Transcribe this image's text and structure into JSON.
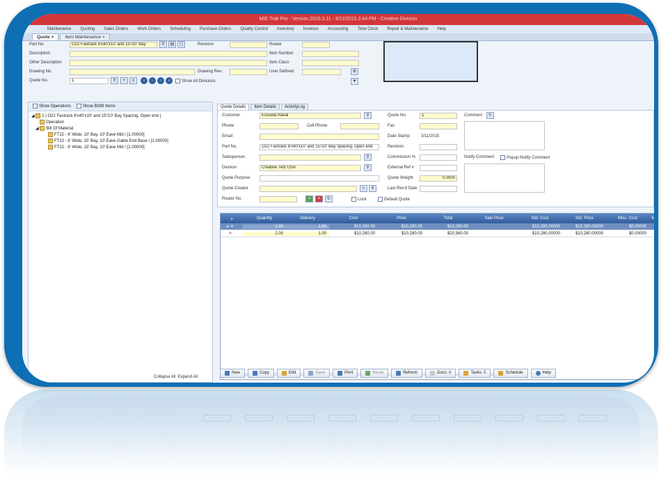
{
  "titlebar": "MIE Trak Pro - Version 2015.3.11 - 3/11/2015 2:44 PM - Creative Division",
  "menu": [
    "Maintenance",
    "Quoting",
    "Sales Orders",
    "Work Orders",
    "Scheduling",
    "Purchase Orders",
    "Quality Control",
    "Inventory",
    "Invoices",
    "Accounting",
    "Time Clock",
    "Repair & Maintenance",
    "Help"
  ],
  "tabs": [
    "Quote",
    "Item Maintenance"
  ],
  "header": {
    "part_no_label": "Part No.",
    "part_no": "O22 Fastrack 6'x40'x10' and 15'/10' Bay",
    "description_label": "Description",
    "other_description_label": "Other Description",
    "drawing_no_label": "Drawing No.",
    "quote_no_label": "Quote No.",
    "quote_no": "1",
    "revision_label": "Revision",
    "drawing_rev_label": "Drawing Rev.",
    "router_label": "Router",
    "item_number_label": "Item Number",
    "item_class_label": "Item Class",
    "user_defined_label": "User Defined",
    "show_all_divisions": "Show All Divisions"
  },
  "left": {
    "show_operations": "Show Operations",
    "show_bom": "Show BOM Items",
    "tree": [
      "1 | O22 Fastrack 6'x40'x10' and 15'/10' Bay Spacing, Open end |",
      "Operation",
      "Bill Of Material",
      "FT22 - 6' Wide, 10' Bay, 10' Eave Mid / [1.00000]",
      "FT22 - 6' Wide, 15' Bay, 10' Eave Gable End Base / [1.00000]",
      "FT22 - 6' Wide, 15' Bay, 10' Eave Mid / [1.00000]"
    ],
    "collapse_all": "Collapse All",
    "expand_all": "Expand All"
  },
  "right_tabs": [
    "Quote Details",
    "Item Details",
    "ActivityLog"
  ],
  "form": {
    "customer_label": "Customer",
    "customer": "Escuela Naval",
    "phone_label": "Phone",
    "cell_phone_label": "Cell Phone",
    "email_label": "Email",
    "part_no_label": "Part No.",
    "part_no": "O22 Fastrack 6'x40'x10' and 15'/10' Bay Spacing, Open end",
    "salesperson_label": "Salesperson",
    "division_label": "Division",
    "division": "Creative Test USA",
    "quote_purpose_label": "Quote Purpose",
    "quote_creator_label": "Quote Creator",
    "router_no_label": "Router No.",
    "lock_label": "Lock",
    "default_quote_label": "Default Quote",
    "quote_no_label": "Quote No.",
    "quote_no": "1",
    "fax_label": "Fax",
    "date_stamp_label": "Date Stamp",
    "date_stamp": "3/11/2015",
    "revision_label": "Revision",
    "commission_label": "Commission %",
    "external_ref_label": "External Ref #",
    "quote_weight_label": "Quote Weight",
    "quote_weight": "0.0000",
    "last_revd_label": "Last Rev'd Date",
    "comment_label": "Comment",
    "notify_comment_label": "Notify Comment",
    "popup_notify_label": "Popup Notify Comment"
  },
  "grid": {
    "columns": [
      "Quantity",
      "Delivery",
      "Cost",
      "Price",
      "Total",
      "Sale Price",
      "Std. Cost",
      "Std. Price",
      "Misc. Cost",
      "M"
    ],
    "rows": [
      [
        "1.00",
        "1.00",
        "$10,280.00",
        "$10,280.00",
        "$10,280.00",
        "",
        "$10,280.00000",
        "$10,280.00000",
        "$0.00000"
      ],
      [
        "2.00",
        "1.00",
        "$10,280.00",
        "$10,280.00",
        "$20,560.00",
        "",
        "$10,280.00000",
        "$10,280.00000",
        "$0.00000"
      ]
    ]
  },
  "footer": [
    "New",
    "Copy",
    "Edit",
    "Save",
    "Print",
    "Reset",
    "Refresh",
    "Docs: 0",
    "Tasks: 0",
    "Schedule",
    "Help"
  ]
}
